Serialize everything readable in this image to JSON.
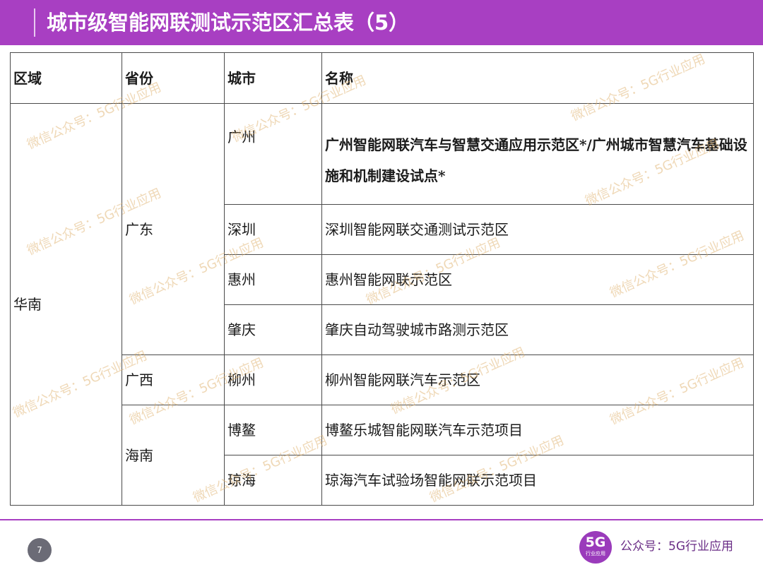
{
  "header": {
    "title": "城市级智能网联测试示范区汇总表（5）",
    "accent_color": "#a83fc2"
  },
  "table": {
    "columns": [
      "区域",
      "省份",
      "城市",
      "名称"
    ],
    "region": "华南",
    "provinces": [
      "广东",
      "广西",
      "海南"
    ],
    "rows": [
      {
        "city": "广州",
        "name": "广州智能网联汽车与智慧交通应用示范区*/广州城市智慧汽车基础设施和机制建设试点*"
      },
      {
        "city": "深圳",
        "name": "深圳智能网联交通测试示范区"
      },
      {
        "city": "惠州",
        "name": "惠州智能网联示范区"
      },
      {
        "city": "肇庆",
        "name": "肇庆自动驾驶城市路测示范区"
      },
      {
        "city": "柳州",
        "name": "柳州智能网联汽车示范区"
      },
      {
        "city": "博鳌",
        "name": "博鳌乐城智能网联汽车示范项目"
      },
      {
        "city": "琼海",
        "name": "琼海汽车试验场智能网联示范项目"
      }
    ]
  },
  "watermark": "微信公众号：5G行业应用",
  "footer": {
    "page_number": "7",
    "logo_big": "5G",
    "logo_small": "行业应用",
    "brand_text": "公众号：5G行业应用"
  }
}
